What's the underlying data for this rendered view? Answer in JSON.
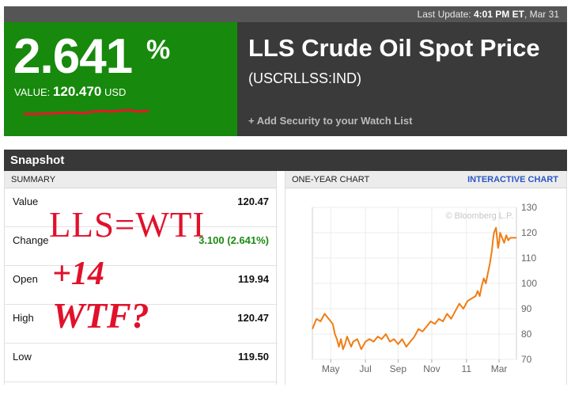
{
  "last_update": {
    "label": "Last Update:",
    "time": "4:01 PM ET",
    "date": "Mar 31"
  },
  "quote": {
    "change_pct": "2.641",
    "pct_sign": "%",
    "value_label": "VALUE:",
    "value": "120.470",
    "currency": "USD",
    "sparkline_color": "#e4182a"
  },
  "title": {
    "name": "LLS Crude Oil Spot Price",
    "ticker": "(USCRLLSS:IND)"
  },
  "watch_link": "+ Add Security to your Watch List",
  "snapshot": {
    "title": "Snapshot",
    "summary_header": "SUMMARY",
    "rows": [
      {
        "label": "Value",
        "value": "120.47"
      },
      {
        "label": "Change",
        "value": "3.100 (2.641%)"
      },
      {
        "label": "Open",
        "value": "119.94"
      },
      {
        "label": "High",
        "value": "120.47"
      },
      {
        "label": "Low",
        "value": "119.50"
      }
    ],
    "chart_header": "ONE-YEAR CHART",
    "chart_link": "INTERACTIVE CHART"
  },
  "annotations": [
    "LLS=WTI",
    "+14",
    "WTF?"
  ],
  "colors": {
    "green": "#17890c",
    "dark": "#3a3a3a",
    "line": "#f07d14",
    "link": "#2a56c6",
    "scrawl": "#e1112b"
  },
  "chart_data": {
    "type": "line",
    "title": "",
    "watermark": "© Bloomberg L.P.",
    "xlabel": "",
    "ylabel": "",
    "ylim": [
      70,
      130
    ],
    "yticks": [
      70,
      80,
      90,
      100,
      110,
      120,
      130
    ],
    "xticks": [
      {
        "label": "May",
        "pos": 0.09
      },
      {
        "label": "Jul",
        "pos": 0.26
      },
      {
        "label": "Sep",
        "pos": 0.42
      },
      {
        "label": "Nov",
        "pos": 0.585
      },
      {
        "label": "11",
        "pos": 0.755
      },
      {
        "label": "Mar",
        "pos": 0.915
      }
    ],
    "grid": true,
    "series": [
      {
        "color": "#f07d14",
        "points": [
          [
            0.0,
            82
          ],
          [
            0.02,
            86
          ],
          [
            0.04,
            85
          ],
          [
            0.06,
            88
          ],
          [
            0.08,
            86
          ],
          [
            0.1,
            84
          ],
          [
            0.11,
            80
          ],
          [
            0.12,
            78
          ],
          [
            0.13,
            75
          ],
          [
            0.14,
            78
          ],
          [
            0.15,
            74
          ],
          [
            0.16,
            76
          ],
          [
            0.17,
            79
          ],
          [
            0.18,
            77
          ],
          [
            0.19,
            75
          ],
          [
            0.2,
            77
          ],
          [
            0.22,
            78
          ],
          [
            0.24,
            74
          ],
          [
            0.26,
            77
          ],
          [
            0.28,
            78
          ],
          [
            0.3,
            77
          ],
          [
            0.32,
            79
          ],
          [
            0.34,
            78
          ],
          [
            0.36,
            80
          ],
          [
            0.38,
            77
          ],
          [
            0.4,
            78
          ],
          [
            0.42,
            76
          ],
          [
            0.44,
            78
          ],
          [
            0.46,
            75
          ],
          [
            0.48,
            77
          ],
          [
            0.5,
            79
          ],
          [
            0.52,
            82
          ],
          [
            0.54,
            81
          ],
          [
            0.56,
            83
          ],
          [
            0.58,
            85
          ],
          [
            0.6,
            84
          ],
          [
            0.62,
            86
          ],
          [
            0.64,
            85
          ],
          [
            0.66,
            88
          ],
          [
            0.68,
            86
          ],
          [
            0.7,
            89
          ],
          [
            0.72,
            92
          ],
          [
            0.74,
            90
          ],
          [
            0.76,
            93
          ],
          [
            0.78,
            94
          ],
          [
            0.8,
            95
          ],
          [
            0.81,
            97
          ],
          [
            0.82,
            95
          ],
          [
            0.83,
            99
          ],
          [
            0.84,
            102
          ],
          [
            0.85,
            100
          ],
          [
            0.86,
            104
          ],
          [
            0.87,
            108
          ],
          [
            0.88,
            113
          ],
          [
            0.885,
            117
          ],
          [
            0.89,
            120
          ],
          [
            0.9,
            122
          ],
          [
            0.905,
            118
          ],
          [
            0.91,
            114
          ],
          [
            0.915,
            116
          ],
          [
            0.92,
            120
          ],
          [
            0.93,
            118
          ],
          [
            0.94,
            116
          ],
          [
            0.95,
            119
          ],
          [
            0.96,
            117
          ],
          [
            0.97,
            118
          ],
          [
            0.98,
            118
          ],
          [
            1.0,
            118
          ]
        ]
      }
    ]
  }
}
